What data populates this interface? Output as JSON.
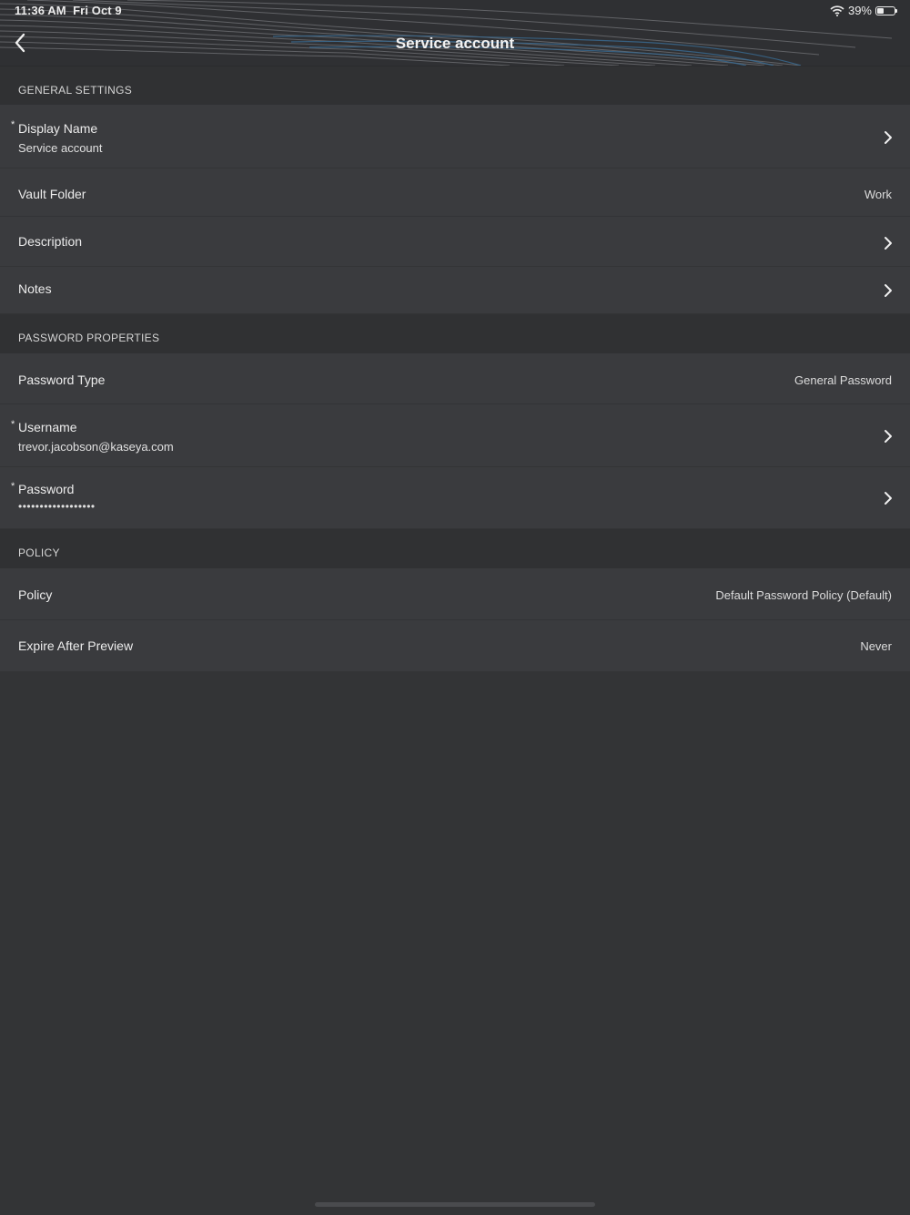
{
  "status_bar": {
    "time": "11:36 AM",
    "date": "Fri Oct 9",
    "battery": "39%",
    "battery_level": 0.39,
    "icons": [
      "wifi-icon",
      "battery-icon"
    ]
  },
  "nav": {
    "title": "Service account",
    "back_icon": "chevron-left-icon"
  },
  "general_settings": {
    "header": "GENERAL SETTINGS",
    "display_name": {
      "label": "Display Name",
      "value": "Service account",
      "required": "*"
    },
    "vault_folder": {
      "label": "Vault Folder",
      "value": "Work"
    },
    "description": {
      "label": "Description"
    },
    "notes": {
      "label": "Notes"
    }
  },
  "password_properties": {
    "header": "PASSWORD PROPERTIES",
    "password_type": {
      "label": "Password Type",
      "value": "General Password"
    },
    "username": {
      "label": "Username",
      "value": "trevor.jacobson@kaseya.com",
      "required": "*"
    },
    "password": {
      "label": "Password",
      "value": "••••••••••••••••••",
      "required": "*"
    }
  },
  "policy": {
    "header": "POLICY",
    "policy": {
      "label": "Policy",
      "value": "Default Password Policy (Default)"
    },
    "expire_after_preview": {
      "label": "Expire After Preview",
      "value": "Never"
    }
  },
  "colors": {
    "background": "#333436",
    "row": "#3a3b3e",
    "section_header": "#303133",
    "wave_accent": "#3a6d95"
  }
}
